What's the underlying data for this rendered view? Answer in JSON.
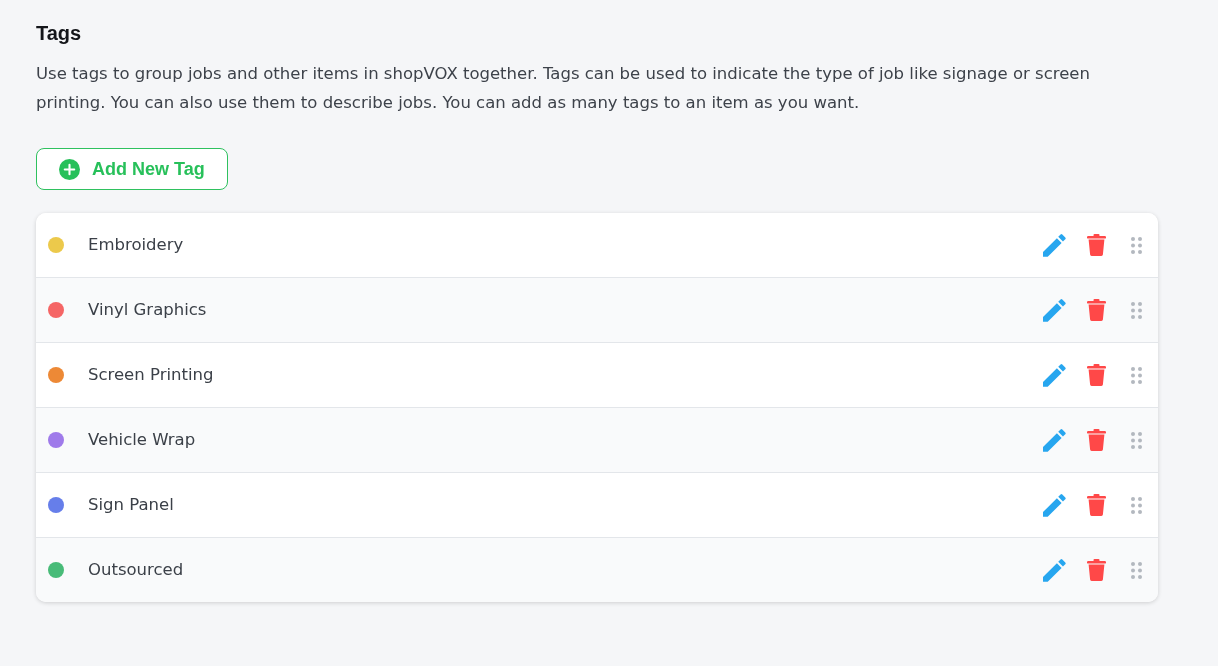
{
  "title": "Tags",
  "description": "Use tags to group jobs and other items in shopVOX together. Tags can be used to indicate the type of job like signage or screen printing. You can also use them to describe jobs. You can add as many tags to an item as you want.",
  "add_button": {
    "label": "Add New Tag"
  },
  "tags": [
    {
      "name": "Embroidery",
      "color": "#ecc94b"
    },
    {
      "name": "Vinyl Graphics",
      "color": "#f56565"
    },
    {
      "name": "Screen Printing",
      "color": "#ed8936"
    },
    {
      "name": "Vehicle Wrap",
      "color": "#9f7aea"
    },
    {
      "name": "Sign Panel",
      "color": "#667eea"
    },
    {
      "name": "Outsourced",
      "color": "#48bb78"
    }
  ]
}
